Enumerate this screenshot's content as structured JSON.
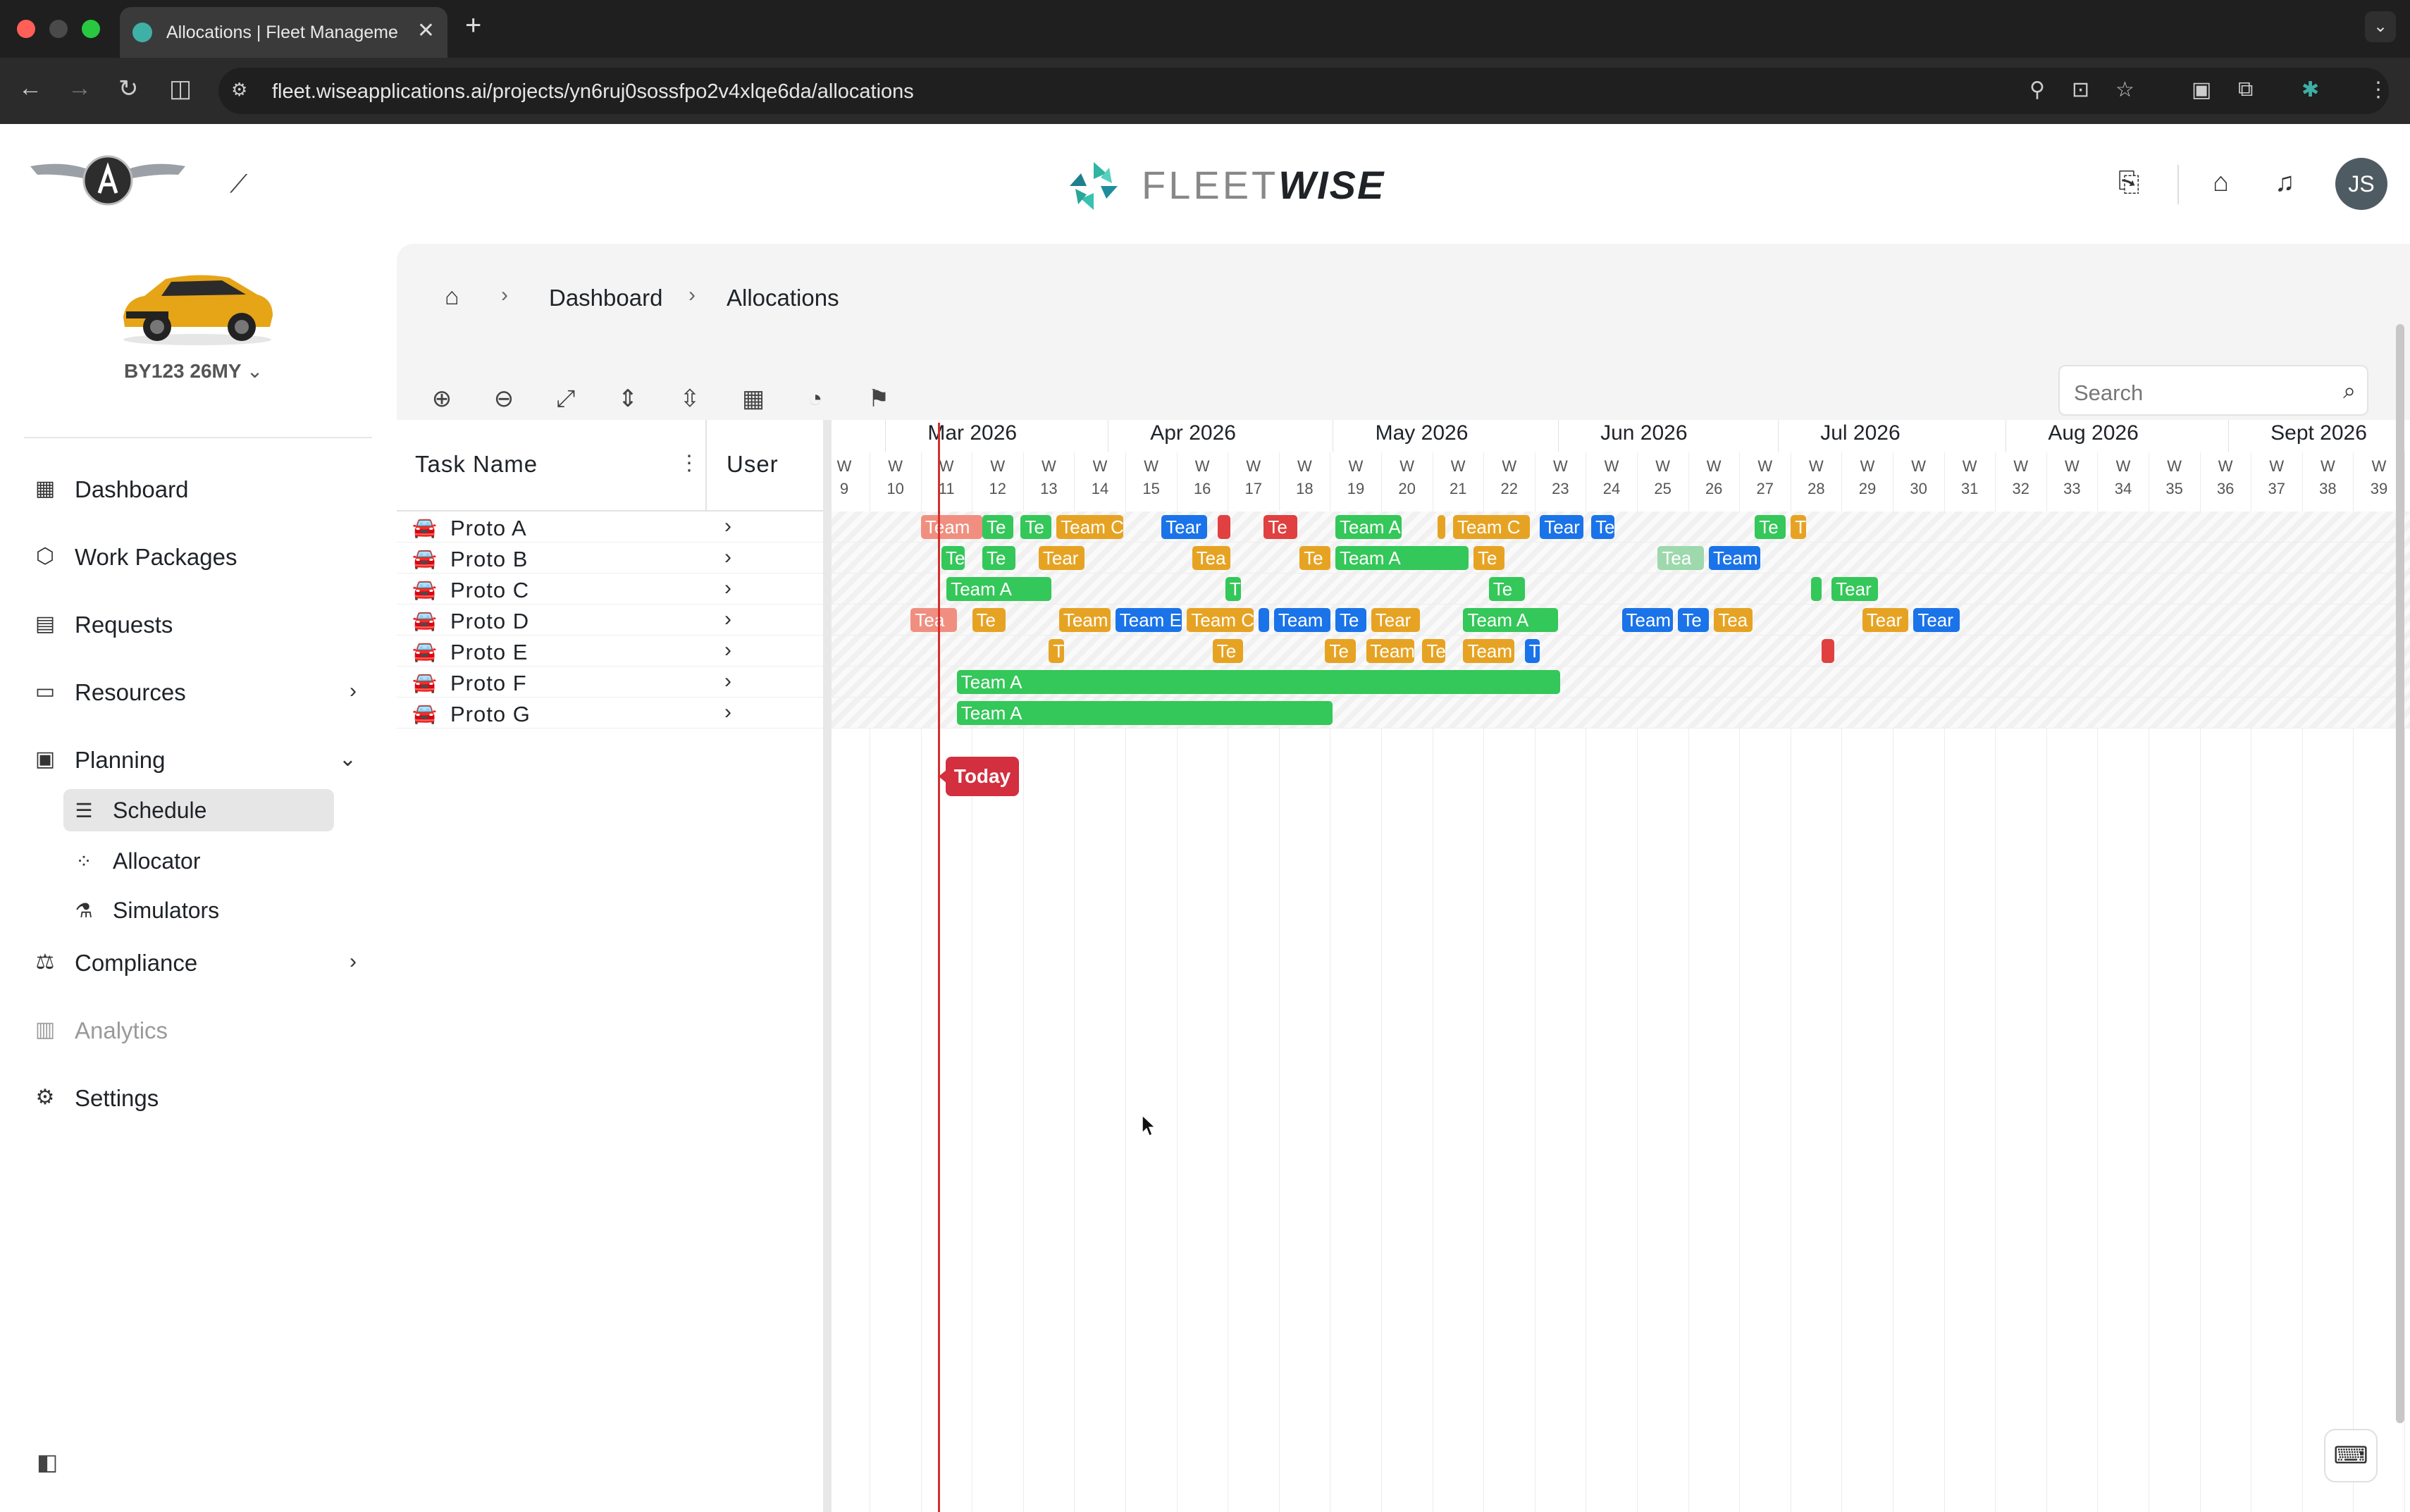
{
  "browser": {
    "tab_title": "Allocations | Fleet Manageme",
    "url": "fleet.wiseapplications.ai/projects/yn6ruj0sossfpo2v4xlqe6da/allocations"
  },
  "header": {
    "brand_light": "FLEET",
    "brand_bold": "WISE",
    "avatar_initials": "JS"
  },
  "sidebar": {
    "vehicle": "BY123 26MY",
    "items": [
      {
        "label": "Dashboard"
      },
      {
        "label": "Work Packages"
      },
      {
        "label": "Requests"
      },
      {
        "label": "Resources"
      },
      {
        "label": "Planning"
      },
      {
        "label": "Compliance"
      },
      {
        "label": "Analytics"
      },
      {
        "label": "Settings"
      }
    ],
    "planning_sub": [
      {
        "label": "Schedule"
      },
      {
        "label": "Allocator"
      },
      {
        "label": "Simulators"
      }
    ]
  },
  "breadcrumb": {
    "dashboard": "Dashboard",
    "current": "Allocations"
  },
  "toolbar": {
    "search_placeholder": "Search"
  },
  "gantt": {
    "col_task": "Task Name",
    "col_user": "User",
    "months": [
      "Mar 2026",
      "Apr 2026",
      "May 2026",
      "Jun 2026",
      "Jul 2026",
      "Aug 2026",
      "Sept 2026"
    ],
    "week_prefix": "W",
    "weeks": [
      "9",
      "10",
      "11",
      "12",
      "13",
      "14",
      "15",
      "16",
      "17",
      "18",
      "19",
      "20",
      "21",
      "22",
      "23",
      "24",
      "25",
      "26",
      "27",
      "28",
      "29",
      "30",
      "31",
      "32",
      "33",
      "34",
      "35",
      "36",
      "37",
      "38",
      "39"
    ],
    "tasks": [
      "Proto A",
      "Proto B",
      "Proto C",
      "Proto D",
      "Proto E",
      "Proto F",
      "Proto G"
    ],
    "today_label": "Today",
    "bars": [
      [
        {
          "t": "Team",
          "c": "pink",
          "s": 10.5,
          "w": 1.2
        },
        {
          "t": "Te",
          "c": "green",
          "s": 11.7,
          "w": 0.6
        },
        {
          "t": "Te",
          "c": "green",
          "s": 12.45,
          "w": 0.6
        },
        {
          "t": "Team C",
          "c": "orange",
          "s": 13.15,
          "w": 1.3
        },
        {
          "t": "Tear",
          "c": "blue",
          "s": 15.2,
          "w": 0.9
        },
        {
          "t": "",
          "c": "red",
          "s": 16.3,
          "w": 0.25
        },
        {
          "t": "Te",
          "c": "red",
          "s": 17.2,
          "w": 0.65
        },
        {
          "t": "Team A",
          "c": "green",
          "s": 18.6,
          "w": 1.3
        },
        {
          "t": "",
          "c": "orange",
          "s": 20.6,
          "w": 0.15
        },
        {
          "t": "Team C",
          "c": "orange",
          "s": 20.9,
          "w": 1.5
        },
        {
          "t": "Tear",
          "c": "blue",
          "s": 22.6,
          "w": 0.85
        },
        {
          "t": "Te",
          "c": "blue",
          "s": 23.6,
          "w": 0.45
        },
        {
          "t": "Te",
          "c": "green",
          "s": 26.8,
          "w": 0.6
        },
        {
          "t": "T",
          "c": "orange",
          "s": 27.5,
          "w": 0.3
        }
      ],
      [
        {
          "t": "Te",
          "c": "green",
          "s": 10.9,
          "w": 0.45
        },
        {
          "t": "Te",
          "c": "green",
          "s": 11.7,
          "w": 0.65
        },
        {
          "t": "Tear",
          "c": "orange",
          "s": 12.8,
          "w": 0.9
        },
        {
          "t": "Tea",
          "c": "orange",
          "s": 15.8,
          "w": 0.75
        },
        {
          "t": "Te",
          "c": "orange",
          "s": 17.9,
          "w": 0.6
        },
        {
          "t": "Team A",
          "c": "green",
          "s": 18.6,
          "w": 2.6
        },
        {
          "t": "Te",
          "c": "orange",
          "s": 21.3,
          "w": 0.6
        },
        {
          "t": "Tea",
          "c": "faded",
          "s": 24.9,
          "w": 0.9
        },
        {
          "t": "Team",
          "c": "blue",
          "s": 25.9,
          "w": 1.0
        }
      ],
      [
        {
          "t": "Team A",
          "c": "green",
          "s": 11.0,
          "w": 2.05
        },
        {
          "t": "T",
          "c": "green",
          "s": 16.45,
          "w": 0.3
        },
        {
          "t": "Te",
          "c": "green",
          "s": 21.6,
          "w": 0.7
        },
        {
          "t": "",
          "c": "green",
          "s": 27.9,
          "w": 0.2
        },
        {
          "t": "Tear",
          "c": "green",
          "s": 28.3,
          "w": 0.9
        }
      ],
      [
        {
          "t": "Tea",
          "c": "pink",
          "s": 10.3,
          "w": 0.9
        },
        {
          "t": "Te",
          "c": "orange",
          "s": 11.5,
          "w": 0.65
        },
        {
          "t": "Team",
          "c": "orange",
          "s": 13.2,
          "w": 1.0
        },
        {
          "t": "Team E",
          "c": "blue",
          "s": 14.3,
          "w": 1.3
        },
        {
          "t": "Team C",
          "c": "orange",
          "s": 15.7,
          "w": 1.3
        },
        {
          "t": "",
          "c": "blue",
          "s": 17.1,
          "w": 0.2
        },
        {
          "t": "Team",
          "c": "blue",
          "s": 17.4,
          "w": 1.1
        },
        {
          "t": "Te",
          "c": "blue",
          "s": 18.6,
          "w": 0.6
        },
        {
          "t": "Tear",
          "c": "orange",
          "s": 19.3,
          "w": 0.95
        },
        {
          "t": "Team A",
          "c": "green",
          "s": 21.1,
          "w": 1.85
        },
        {
          "t": "Team",
          "c": "blue",
          "s": 24.2,
          "w": 1.0
        },
        {
          "t": "Te",
          "c": "blue",
          "s": 25.3,
          "w": 0.6
        },
        {
          "t": "Tea",
          "c": "orange",
          "s": 26.0,
          "w": 0.75
        },
        {
          "t": "Tear",
          "c": "orange",
          "s": 28.9,
          "w": 0.9
        },
        {
          "t": "Tear",
          "c": "blue",
          "s": 29.9,
          "w": 0.9
        }
      ],
      [
        {
          "t": "T",
          "c": "orange",
          "s": 13.0,
          "w": 0.3
        },
        {
          "t": "Te",
          "c": "orange",
          "s": 16.2,
          "w": 0.6
        },
        {
          "t": "Te",
          "c": "orange",
          "s": 18.4,
          "w": 0.6
        },
        {
          "t": "Team",
          "c": "orange",
          "s": 19.2,
          "w": 0.95
        },
        {
          "t": "Te",
          "c": "orange",
          "s": 20.3,
          "w": 0.45
        },
        {
          "t": "Team",
          "c": "orange",
          "s": 21.1,
          "w": 1.0
        },
        {
          "t": "T",
          "c": "blue",
          "s": 22.3,
          "w": 0.3
        },
        {
          "t": "",
          "c": "red",
          "s": 28.1,
          "w": 0.25
        }
      ],
      [
        {
          "t": "Team A",
          "c": "green",
          "s": 11.2,
          "w": 11.8
        }
      ],
      [
        {
          "t": "Team A",
          "c": "green",
          "s": 11.2,
          "w": 7.35
        }
      ]
    ]
  }
}
